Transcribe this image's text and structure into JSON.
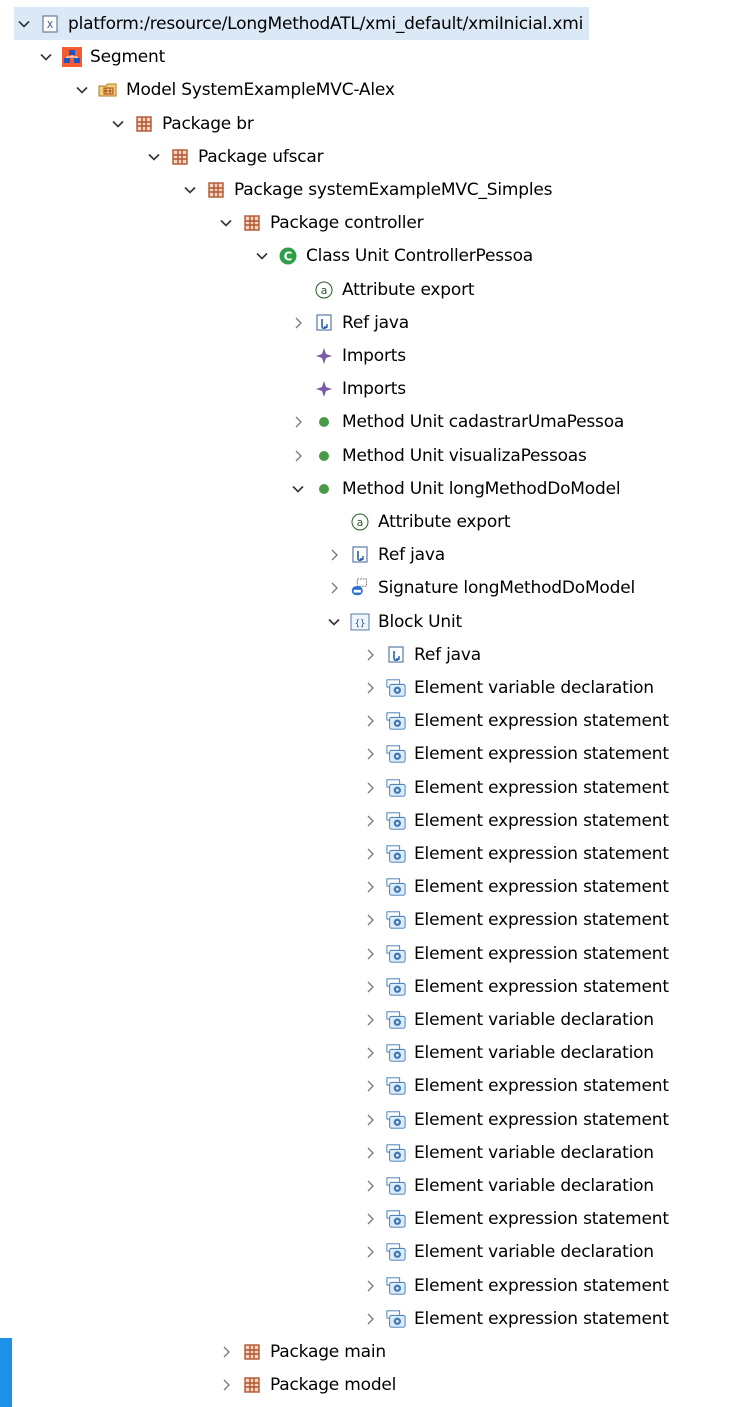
{
  "tree": {
    "root": {
      "label": "platform:/resource/LongMethodATL/xmi_default/xmiInicial.xmi",
      "icon": "xmi-file-icon",
      "expanded": true
    },
    "nodes": [
      {
        "label": "Segment",
        "icon": "segment-icon",
        "expanded": true
      },
      {
        "label": "Model SystemExampleMVC-Alex",
        "icon": "model-icon",
        "expanded": true
      },
      {
        "label": "Package br",
        "icon": "package-icon",
        "expanded": true
      },
      {
        "label": "Package ufscar",
        "icon": "package-icon",
        "expanded": true
      },
      {
        "label": "Package systemExampleMVC_Simples",
        "icon": "package-icon",
        "expanded": true
      },
      {
        "label": "Package controller",
        "icon": "package-icon",
        "expanded": true
      },
      {
        "label": "Class Unit ControllerPessoa",
        "icon": "class-icon",
        "expanded": true
      },
      {
        "label": "Attribute export",
        "icon": "attribute-icon",
        "expanded": null
      },
      {
        "label": "Ref java",
        "icon": "ref-icon",
        "expanded": false
      },
      {
        "label": "Imports",
        "icon": "imports-icon",
        "expanded": null
      },
      {
        "label": "Imports",
        "icon": "imports-icon",
        "expanded": null
      },
      {
        "label": "Method Unit cadastrarUmaPessoa",
        "icon": "method-icon",
        "expanded": false
      },
      {
        "label": "Method Unit visualizaPessoas",
        "icon": "method-icon",
        "expanded": false
      },
      {
        "label": "Method Unit longMethodDoModel",
        "icon": "method-icon",
        "expanded": true
      },
      {
        "label": "Attribute export",
        "icon": "attribute-icon",
        "expanded": null
      },
      {
        "label": "Ref java",
        "icon": "ref-icon",
        "expanded": false
      },
      {
        "label": "Signature longMethodDoModel",
        "icon": "signature-icon",
        "expanded": false
      },
      {
        "label": "Block Unit",
        "icon": "block-icon",
        "expanded": true
      },
      {
        "label": "Ref java",
        "icon": "ref-icon",
        "expanded": false
      },
      {
        "label": "Element variable declaration",
        "icon": "element-icon",
        "expanded": false
      },
      {
        "label": "Element expression statement",
        "icon": "element-icon",
        "expanded": false
      },
      {
        "label": "Element expression statement",
        "icon": "element-icon",
        "expanded": false
      },
      {
        "label": "Element expression statement",
        "icon": "element-icon",
        "expanded": false
      },
      {
        "label": "Element expression statement",
        "icon": "element-icon",
        "expanded": false
      },
      {
        "label": "Element expression statement",
        "icon": "element-icon",
        "expanded": false
      },
      {
        "label": "Element expression statement",
        "icon": "element-icon",
        "expanded": false
      },
      {
        "label": "Element expression statement",
        "icon": "element-icon",
        "expanded": false
      },
      {
        "label": "Element expression statement",
        "icon": "element-icon",
        "expanded": false
      },
      {
        "label": "Element expression statement",
        "icon": "element-icon",
        "expanded": false
      },
      {
        "label": "Element variable declaration",
        "icon": "element-icon",
        "expanded": false
      },
      {
        "label": "Element variable declaration",
        "icon": "element-icon",
        "expanded": false
      },
      {
        "label": "Element expression statement",
        "icon": "element-icon",
        "expanded": false
      },
      {
        "label": "Element expression statement",
        "icon": "element-icon",
        "expanded": false
      },
      {
        "label": "Element variable declaration",
        "icon": "element-icon",
        "expanded": false
      },
      {
        "label": "Element variable declaration",
        "icon": "element-icon",
        "expanded": false
      },
      {
        "label": "Element expression statement",
        "icon": "element-icon",
        "expanded": false
      },
      {
        "label": "Element variable declaration",
        "icon": "element-icon",
        "expanded": false
      },
      {
        "label": "Element expression statement",
        "icon": "element-icon",
        "expanded": false
      },
      {
        "label": "Element expression statement",
        "icon": "element-icon",
        "expanded": false
      },
      {
        "label": "Package main",
        "icon": "package-icon",
        "expanded": false
      },
      {
        "label": "Package model",
        "icon": "package-icon",
        "expanded": false
      }
    ]
  },
  "colors": {
    "selection": "#dbe9f7",
    "package": "#b0552f",
    "class": "#2e9e4a",
    "method": "#4a9a4a",
    "element": "#3c78b4",
    "edge_accent": "#1e90e6"
  }
}
